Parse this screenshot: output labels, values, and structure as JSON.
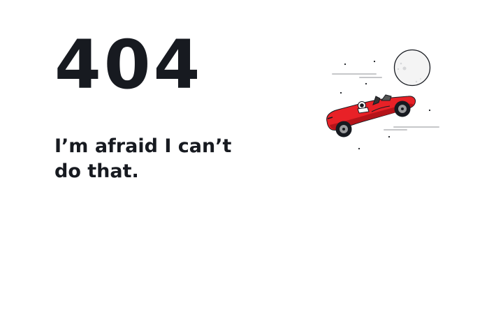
{
  "error": {
    "code": "404",
    "message": "I’m afraid I can’t do that."
  },
  "illustration": {
    "name": "roadster-in-space",
    "colors": {
      "car_body": "#e82127",
      "car_shadow": "#b5141a",
      "moon": "#f4f4f4",
      "outline": "#171a20",
      "speed_lines": "#c6c7c9"
    }
  }
}
